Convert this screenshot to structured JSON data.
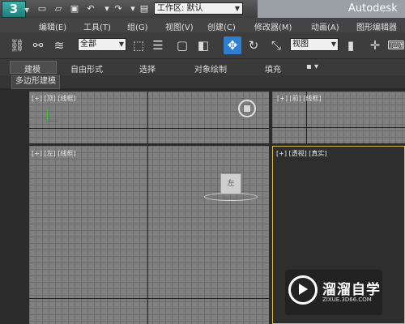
{
  "title_bar": {
    "app_title": "Autodesk 3",
    "workspace_label": "工作区: 默认",
    "quick_access": [
      "new-icon",
      "open-icon",
      "save-icon",
      "undo-icon",
      "redo-icon",
      "project-icon"
    ]
  },
  "menu": {
    "items": [
      "编辑(E)",
      "工具(T)",
      "组(G)",
      "视图(V)",
      "创建(C)",
      "修改器(M)",
      "动画(A)",
      "图形编辑器(D"
    ]
  },
  "toolbar": {
    "selection_filter": "全部",
    "reference_coord": "视图"
  },
  "ribbon": {
    "tabs": [
      "建模",
      "自由形式",
      "选择",
      "对象绘制",
      "填充"
    ],
    "active_tab": "建模",
    "extra": "▪ ▾",
    "subpanel": "多边形建模"
  },
  "viewports": {
    "top": {
      "label": "[+] [顶] [线框]"
    },
    "front": {
      "label": "[+] [前] [线框]"
    },
    "left": {
      "label": "[+] [左] [线框]"
    },
    "perspective": {
      "label": "[+] [透视] [真实]"
    },
    "viewcube_face": "左",
    "highlight_color": "#d6b84a"
  },
  "watermark": {
    "title": "溜溜自学",
    "url": "ZIXUE.3D66.COM"
  }
}
